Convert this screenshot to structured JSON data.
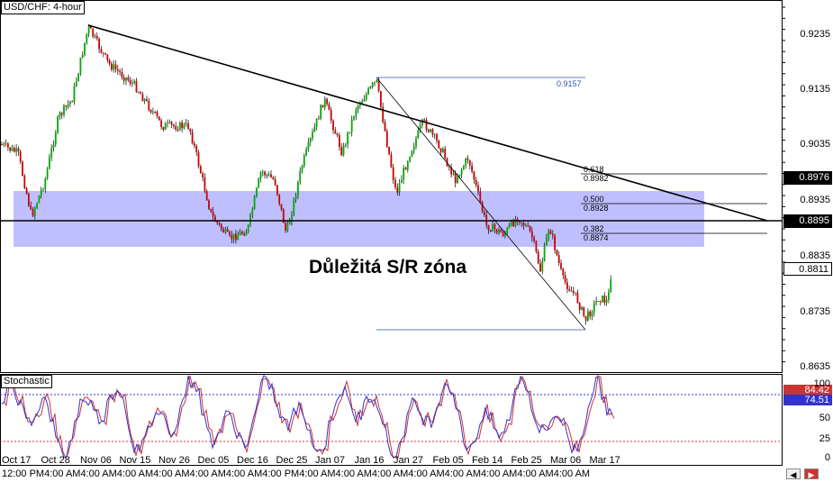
{
  "window": {
    "title": "USD/CHF: 4-hour"
  },
  "indicator": {
    "name": "Stochastic"
  },
  "price_axis": {
    "ticks": [
      "0.9235",
      "0.9135",
      "0.9035",
      "0.8935",
      "0.8835",
      "0.8735",
      "0.8635"
    ],
    "tags": {
      "fib_618": "0.8976",
      "support_line": "0.8895",
      "current": "0.8811"
    }
  },
  "stoch_axis": {
    "ticks": [
      "100",
      "50",
      "25",
      "0"
    ],
    "tags": {
      "k": "84.42",
      "d": "74.51"
    }
  },
  "time_axis": {
    "labels": [
      "Oct 17",
      "Oct 28",
      "Nov 06",
      "Nov 15",
      "Nov 26",
      "Dec 05",
      "Dec 16",
      "Dec 25",
      "Jan 07",
      "Jan 16",
      "Jan 27",
      "Feb 05",
      "Feb 14",
      "Feb 25",
      "Mar 06",
      "Mar 17"
    ],
    "sublabels": "12:00 PM4:00 AM4:00 AM4:00 AM4:00 AM4:00 AM4:00 AM4:00 PM4:00 AM4:00 AM4:00 AM4:00 AM4:00 AM4:00 AM4:00 AM4:00 AM"
  },
  "annotations": {
    "zone_label": "Důležitá S/R zóna",
    "swing_high": "0.9157",
    "fib": [
      {
        "level": "0.618",
        "price": "0.8982"
      },
      {
        "level": "0.500",
        "price": "0.8928"
      },
      {
        "level": "0.382",
        "price": "0.8874"
      }
    ]
  },
  "colors": {
    "bull_candle": "#00aa00",
    "bear_candle": "#cc0000",
    "zone": "#b4b4ff",
    "stoch_k": "#3333cc",
    "stoch_d": "#cc3333",
    "level_80": "#3333cc",
    "level_20": "#cc3333"
  },
  "toolbar": {
    "scroll_left_icon": "scroll-left-icon",
    "scroll_right_icon": "scroll-right-icon"
  }
}
